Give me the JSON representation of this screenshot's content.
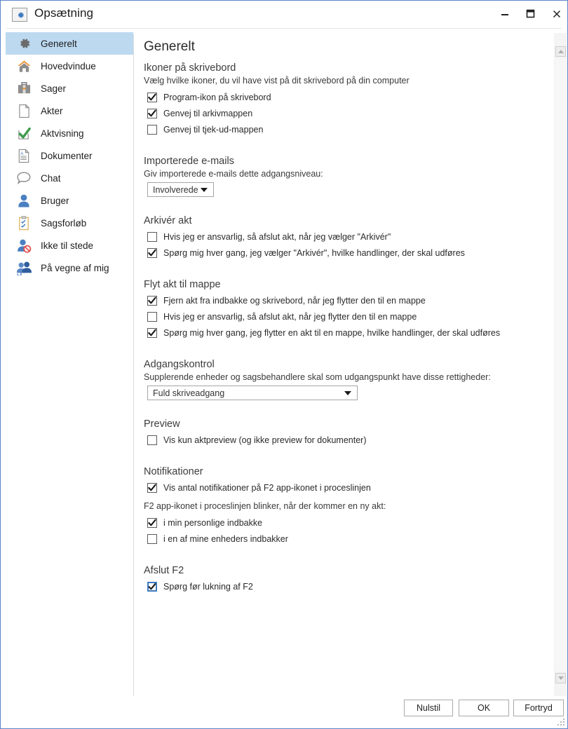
{
  "window": {
    "title": "Opsætning",
    "icon": "gear-icon",
    "controls": {
      "minimize": "−",
      "maximize": "▣",
      "close": "✕"
    }
  },
  "sidebar": {
    "items": [
      {
        "label": "Generelt",
        "icon": "gear-icon",
        "selected": true
      },
      {
        "label": "Hovedvindue",
        "icon": "home-icon",
        "selected": false
      },
      {
        "label": "Sager",
        "icon": "briefcase-icon",
        "selected": false
      },
      {
        "label": "Akter",
        "icon": "document-icon",
        "selected": false
      },
      {
        "label": "Aktvisning",
        "icon": "checkmark-icon",
        "selected": false
      },
      {
        "label": "Dokumenter",
        "icon": "text-doc-icon",
        "selected": false
      },
      {
        "label": "Chat",
        "icon": "speech-bubble-icon",
        "selected": false
      },
      {
        "label": "Bruger",
        "icon": "person-icon",
        "selected": false
      },
      {
        "label": "Sagsforløb",
        "icon": "clipboard-icon",
        "selected": false
      },
      {
        "label": "Ikke til stede",
        "icon": "person-blocked-icon",
        "selected": false
      },
      {
        "label": "På vegne af mig",
        "icon": "people-icon",
        "selected": false
      }
    ]
  },
  "main": {
    "title": "Generelt",
    "sections": {
      "desktop_icons": {
        "heading": "Ikoner på skrivebord",
        "description": "Vælg hvilke ikoner, du vil have vist på dit skrivebord på din computer",
        "checkbox_1": "Program-ikon på skrivebord",
        "checkbox_2": "Genvej til arkivmappen",
        "checkbox_3": "Genvej til tjek-ud-mappen"
      },
      "imported_emails": {
        "heading": "Importerede e-mails",
        "description": "Giv importerede e-mails dette adgangsniveau:",
        "dropdown_value": "Involverede"
      },
      "archive_act": {
        "heading": "Arkivér akt",
        "checkbox_1": "Hvis jeg er ansvarlig, så afslut akt, når jeg vælger \"Arkivér\"",
        "checkbox_2": "Spørg mig hver gang, jeg vælger \"Arkivér\", hvilke handlinger, der skal udføres"
      },
      "move_act": {
        "heading": "Flyt akt til mappe",
        "checkbox_1": "Fjern akt fra indbakke og skrivebord, når jeg flytter den til en mappe",
        "checkbox_2": "Hvis jeg er ansvarlig, så afslut akt, når jeg flytter den til en mappe",
        "checkbox_3": "Spørg mig hver gang, jeg flytter en akt til en mappe, hvilke handlinger, der skal udføres"
      },
      "access_control": {
        "heading": "Adgangskontrol",
        "description": "Supplerende enheder og sagsbehandlere skal som udgangspunkt have disse rettigheder:",
        "dropdown_value": "Fuld skriveadgang"
      },
      "preview": {
        "heading": "Preview",
        "checkbox_1": "Vis kun aktpreview (og ikke preview for dokumenter)"
      },
      "notifications": {
        "heading": "Notifikationer",
        "checkbox_1": "Vis antal notifikationer på F2 app-ikonet i proceslinjen",
        "description": "F2 app-ikonet i proceslinjen blinker, når der kommer en ny akt:",
        "checkbox_2": "i min personlige indbakke",
        "checkbox_3": "i en af mine enheders indbakker"
      },
      "exit_f2": {
        "heading": "Afslut F2",
        "checkbox_1": "Spørg før lukning af F2"
      }
    }
  },
  "footer": {
    "reset_label": "Nulstil",
    "ok_label": "OK",
    "cancel_label": "Fortryd"
  },
  "colors": {
    "accent": "#5b86c9",
    "selection": "#bcd9f0",
    "focus_outline": "#3d7bbf"
  }
}
